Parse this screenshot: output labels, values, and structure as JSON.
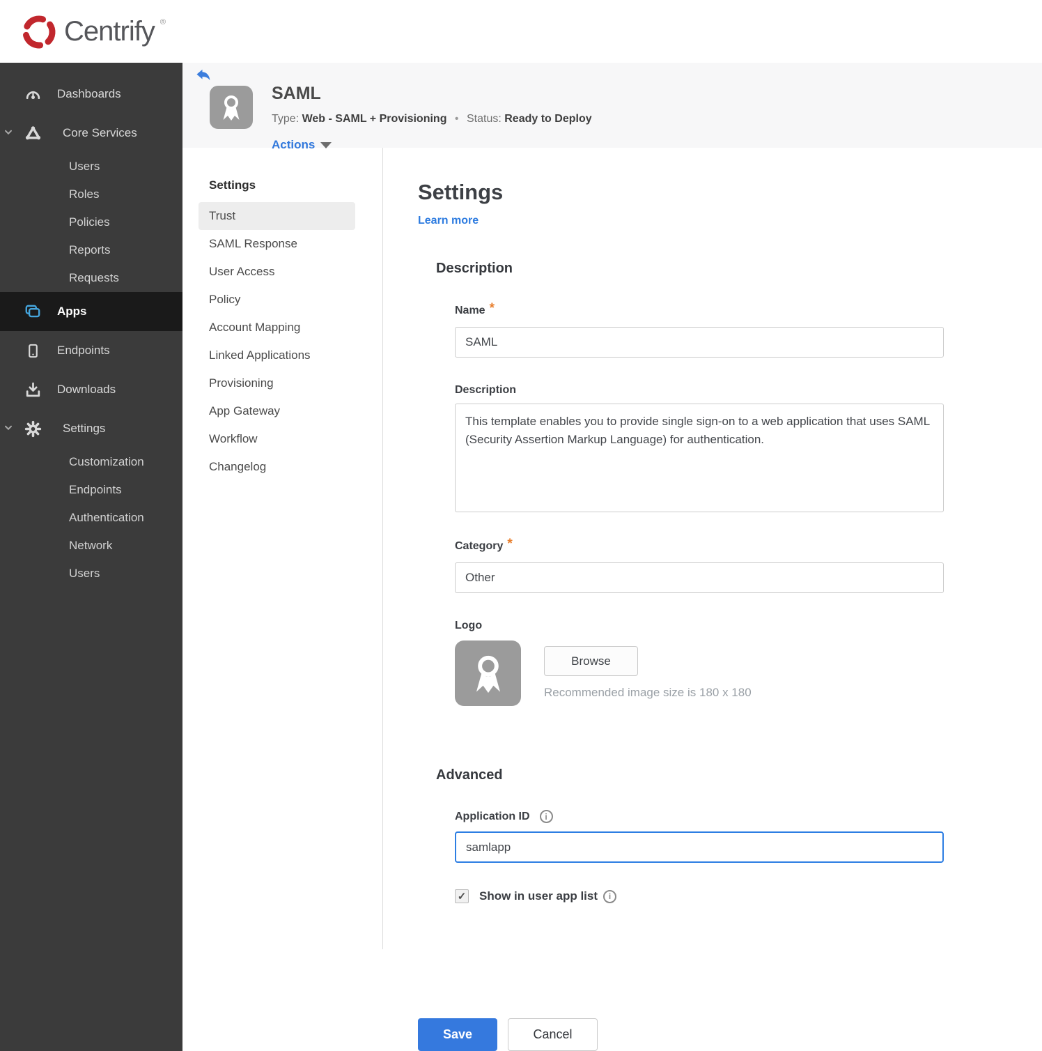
{
  "brand": {
    "name": "Centrify",
    "trademark": "®"
  },
  "icons": {
    "info": "i",
    "check": "✓",
    "required": "*"
  },
  "colors": {
    "accent_blue": "#3178dc",
    "status_red": "#a62320",
    "brand_red": "#c1272d",
    "apps_icon_blue": "#45a5dd",
    "sidebar_bg": "#3b3b3b",
    "header_bg": "#f7f7f8"
  },
  "sidebar": {
    "items": [
      {
        "label": "Dashboards"
      },
      {
        "label": "Core Services",
        "expanded": true,
        "children": [
          "Users",
          "Roles",
          "Policies",
          "Reports",
          "Requests"
        ]
      },
      {
        "label": "Apps",
        "active": true
      },
      {
        "label": "Endpoints"
      },
      {
        "label": "Downloads"
      },
      {
        "label": "Settings",
        "expanded": true,
        "children": [
          "Customization",
          "Endpoints",
          "Authentication",
          "Network",
          "Users"
        ]
      }
    ]
  },
  "header": {
    "app_name": "SAML",
    "type_label": "Type:",
    "type_value": "Web - SAML + Provisioning",
    "separator": "•",
    "status_label": "Status:",
    "status_value": "Ready to Deploy",
    "actions_label": "Actions"
  },
  "subnav": {
    "title": "Settings",
    "active_item": "Trust",
    "items": [
      "Trust",
      "SAML Response",
      "User Access",
      "Policy",
      "Account Mapping",
      "Linked Applications",
      "Provisioning",
      "App Gateway",
      "Workflow",
      "Changelog"
    ]
  },
  "main": {
    "title": "Settings",
    "learn_more": "Learn more",
    "description_section": {
      "heading": "Description",
      "name_label": "Name",
      "name_value": "SAML",
      "description_label": "Description",
      "description_value": "This template enables you to provide single sign-on to a web application that uses SAML (Security Assertion Markup Language) for authentication.",
      "category_label": "Category",
      "category_value": "Other",
      "logo_label": "Logo",
      "browse_label": "Browse",
      "logo_hint": "Recommended image size is 180 x 180"
    },
    "advanced_section": {
      "heading": "Advanced",
      "app_id_label": "Application ID",
      "app_id_value": "samlapp",
      "show_in_list_label": "Show in user app list",
      "show_in_list_checked": true
    },
    "save_label": "Save",
    "cancel_label": "Cancel"
  }
}
